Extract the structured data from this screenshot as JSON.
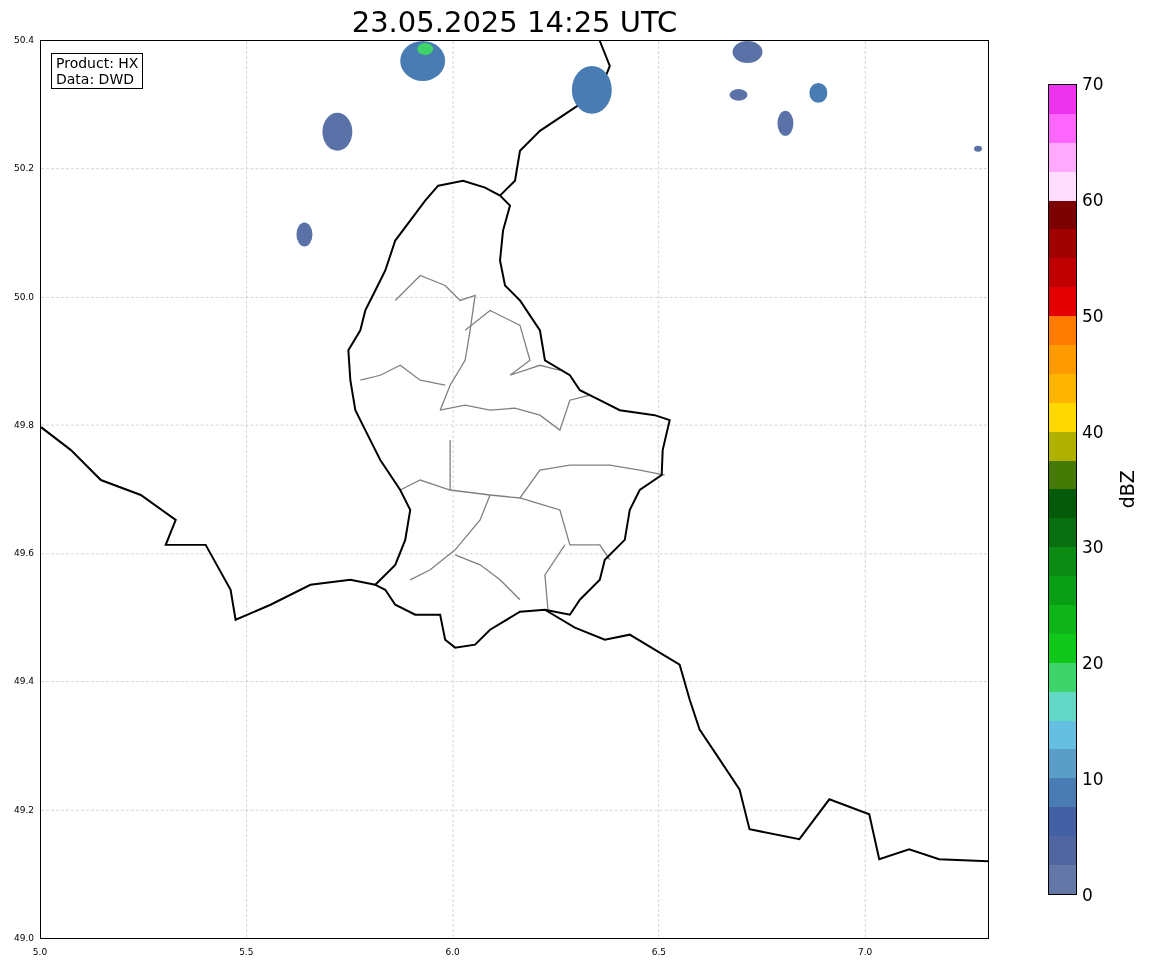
{
  "title": "23.05.2025 14:25 UTC",
  "info_box": [
    "Product: HX",
    "Data: DWD"
  ],
  "axes": {
    "xticks": [
      "5.0",
      "5.5",
      "6.0",
      "6.5",
      "7.0"
    ],
    "yticks": [
      "50.4",
      "50.2",
      "50.0",
      "49.8",
      "49.6",
      "49.4",
      "49.2",
      "49.0"
    ]
  },
  "colorbar": {
    "label": "dBZ",
    "ticks": [
      "70",
      "60",
      "50",
      "40",
      "30",
      "20",
      "10",
      "0"
    ],
    "bands": [
      {
        "color": "#ee33ee"
      },
      {
        "color": "#ff66ff"
      },
      {
        "color": "#ffaaff"
      },
      {
        "color": "#ffddff"
      },
      {
        "color": "#7b0000"
      },
      {
        "color": "#a00000"
      },
      {
        "color": "#c00000"
      },
      {
        "color": "#e40000"
      },
      {
        "color": "#ff7a00"
      },
      {
        "color": "#ff9a00"
      },
      {
        "color": "#ffb400"
      },
      {
        "color": "#ffd800"
      },
      {
        "color": "#b0b000"
      },
      {
        "color": "#467a06"
      },
      {
        "color": "#045a08"
      },
      {
        "color": "#076f10"
      },
      {
        "color": "#0b8a14"
      },
      {
        "color": "#0a9e14"
      },
      {
        "color": "#0eb418"
      },
      {
        "color": "#10c81a"
      },
      {
        "color": "#3fd46a"
      },
      {
        "color": "#63d8c6"
      },
      {
        "color": "#64bfe0"
      },
      {
        "color": "#5a9ec8"
      },
      {
        "color": "#4a7cb4"
      },
      {
        "color": "#4460a4"
      },
      {
        "color": "#5066a0"
      },
      {
        "color": "#6478a8"
      }
    ]
  }
}
